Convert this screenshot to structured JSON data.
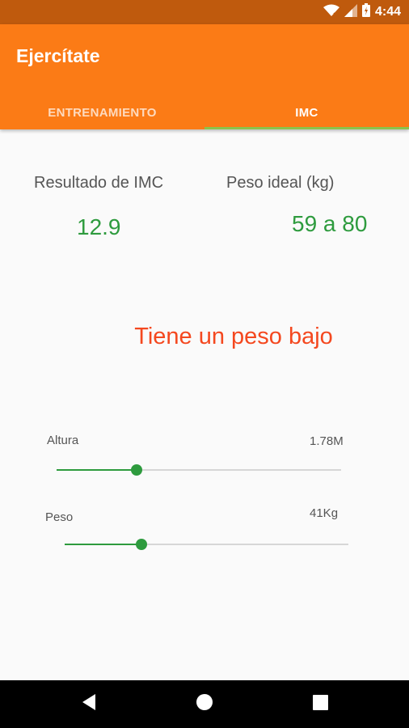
{
  "status_bar": {
    "time": "4:44",
    "icons": [
      "wifi-icon",
      "signal-icon",
      "battery-icon"
    ]
  },
  "app": {
    "title": "Ejercítate",
    "colors": {
      "primary": "#fb7b16",
      "primary_dark": "#bf5a0d",
      "accent": "#8bc34a",
      "value_green": "#2e9b3e",
      "warning_red": "#f4481f"
    }
  },
  "tabs": [
    {
      "label": "ENTRENAMIENTO",
      "selected": false
    },
    {
      "label": "IMC",
      "selected": true
    }
  ],
  "results": {
    "bmi_label": "Resultado de IMC",
    "bmi_value": "12.9",
    "ideal_label": "Peso ideal (kg)",
    "ideal_value": "59 a 80"
  },
  "message": "Tiene un peso bajo",
  "sliders": {
    "height": {
      "label": "Altura",
      "value_text": "1.78M",
      "level_fraction": 0.28
    },
    "weight": {
      "label": "Peso",
      "value_text": "41Kg",
      "level_fraction": 0.27
    }
  },
  "nav_bar": {
    "buttons": [
      "back-icon",
      "home-icon",
      "recents-icon"
    ]
  }
}
